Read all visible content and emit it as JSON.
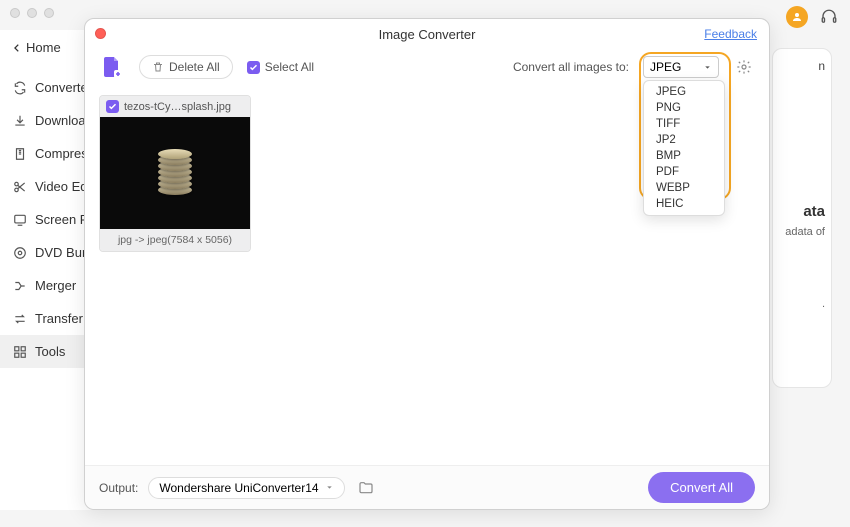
{
  "window": {
    "back_label": "Home"
  },
  "sidebar": {
    "items": [
      {
        "icon": "sync",
        "label": "Converter"
      },
      {
        "icon": "download",
        "label": "Downloader"
      },
      {
        "icon": "compress",
        "label": "Compressor"
      },
      {
        "icon": "scissors",
        "label": "Video Editor"
      },
      {
        "icon": "screen",
        "label": "Screen Recorder"
      },
      {
        "icon": "disc",
        "label": "DVD Burner"
      },
      {
        "icon": "merge",
        "label": "Merger"
      },
      {
        "icon": "transfer",
        "label": "Transfer"
      },
      {
        "icon": "grid",
        "label": "Tools"
      }
    ]
  },
  "rpanel": {
    "line1": "n",
    "hdr": "ata",
    "sm": "adata of",
    "dot": "."
  },
  "modal": {
    "title": "Image Converter",
    "feedback": "Feedback",
    "toolbar": {
      "delete_all": "Delete All",
      "select_all": "Select All",
      "convert_to": "Convert all images to:",
      "format_value": "JPEG"
    },
    "format_options": [
      "JPEG",
      "PNG",
      "TIFF",
      "JP2",
      "BMP",
      "PDF",
      "WEBP",
      "HEIC"
    ],
    "file": {
      "name": "tezos-tCy…splash.jpg",
      "meta": "jpg -> jpeg(7584 x 5056)"
    },
    "bottom": {
      "output_label": "Output:",
      "output_value": "Wondershare UniConverter14",
      "convert_all": "Convert All"
    }
  }
}
